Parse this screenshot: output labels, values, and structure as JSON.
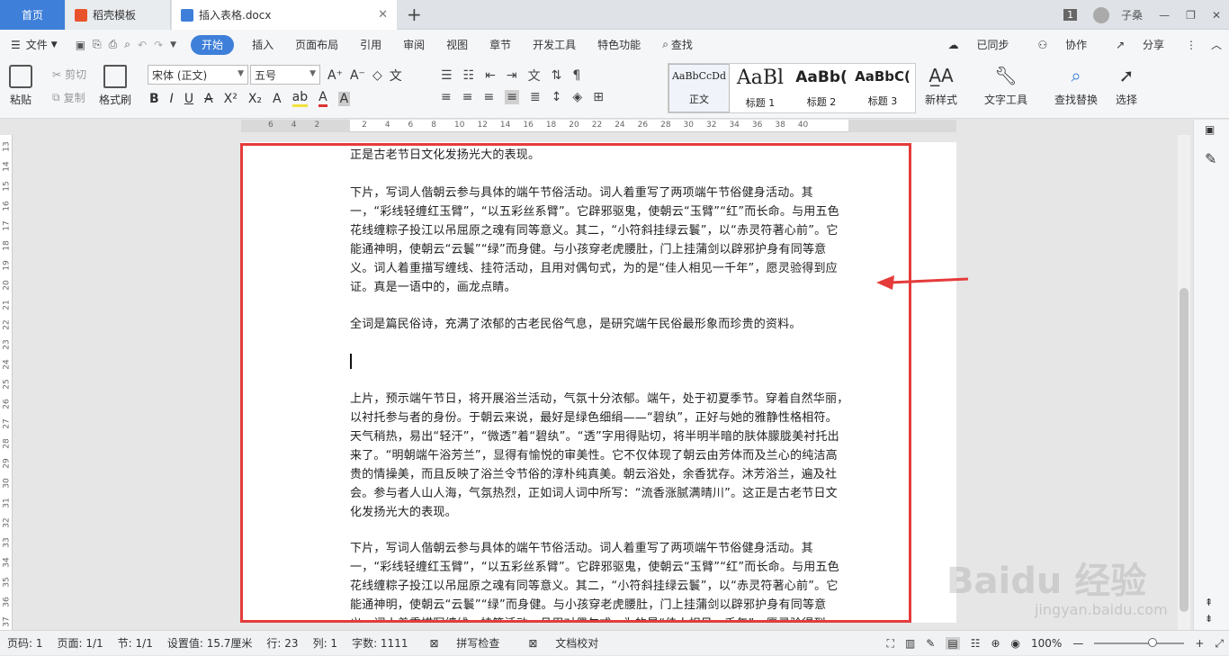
{
  "tabs": {
    "home": "首页",
    "t1": "稻壳模板",
    "t2": "插入表格.docx",
    "user": "子桑",
    "page_num": "1"
  },
  "menu": {
    "file": "文件",
    "items": [
      "开始",
      "插入",
      "页面布局",
      "引用",
      "审阅",
      "视图",
      "章节",
      "开发工具",
      "特色功能",
      "查找"
    ],
    "synced": "已同步",
    "collab": "协作",
    "share": "分享"
  },
  "ribbon": {
    "paste": "粘贴",
    "cut": "剪切",
    "copy": "复制",
    "format_painter": "格式刷",
    "font_name": "宋体 (正文)",
    "font_size": "五号",
    "styles": [
      {
        "sample": "AaBbCcDd",
        "name": "正文"
      },
      {
        "sample": "AaBl",
        "name": "标题 1"
      },
      {
        "sample": "AaBb(",
        "name": "标题 2"
      },
      {
        "sample": "AaBbC(",
        "name": "标题 3"
      }
    ],
    "new_style": "新样式",
    "text_tools": "文字工具",
    "find_replace": "查找替换",
    "select": "选择"
  },
  "document": {
    "paragraphs": [
      "正是古老节日文化发扬光大的表现。",
      "下片，写词人偕朝云参与具体的端午节俗活动。词人着重写了两项端午节俗健身活动。其一，“彩线轻缠红玉臂”，“以五彩丝系臂”。它辟邪驱鬼，使朝云“玉臂”“红”而长命。与用五色花线缠粽子投江以吊屈原之魂有同等意义。其二，“小符斜挂绿云鬟”，以“赤灵符著心前”。它能通神明，使朝云“云鬟”“绿”而身健。与小孩穿老虎腰肚，门上挂蒲剑以辟邪护身有同等意义。词人着重描写缠线、挂符活动，且用对偶句式，为的是“佳人相见一千年”，愿灵验得到应证。真是一语中的，画龙点睛。",
      "全词是篇民俗诗，充满了浓郁的古老民俗气息，是研究端午民俗最形象而珍贵的资料。",
      "上片，预示端午节日，将开展浴兰活动，气氛十分浓郁。端午，处于初夏季节。穿着自然华丽，以衬托参与者的身份。于朝云来说，最好是绿色细绢——“碧纨”，正好与她的雅静性格相符。天气稍热，易出“轻汗”，“微透”着“碧纨”。“透”字用得贴切，将半明半暗的肤体朦胧美衬托出来了。“明朝端午浴芳兰”，显得有愉悦的审美性。它不仅体现了朝云由芳体而及兰心的纯洁高贵的情操美，而且反映了浴兰令节俗的淳朴纯真美。朝云浴处，余香犹存。沐芳浴兰，遍及社会。参与者人山人海，气氛热烈，正如词人词中所写：“流香涨腻满晴川”。这正是古老节日文化发扬光大的表现。",
      "下片，写词人偕朝云参与具体的端午节俗活动。词人着重写了两项端午节俗健身活动。其一，“彩线轻缠红玉臂”，“以五彩丝系臂”。它辟邪驱鬼，使朝云“玉臂”“红”而长命。与用五色花线缠粽子投江以吊屈原之魂有同等意义。其二，“小符斜挂绿云鬟”，以“赤灵符著心前”。它能通神明，使朝云“云鬟”“绿”而身健。与小孩穿老虎腰肚，门上挂蒲剑以辟邪护身有同等意义。词人着重描写缠线、挂符活动，且用对偶句式，为的是“佳人相见一千年”，愿灵验得到"
    ]
  },
  "status": {
    "page_code": "页码: 1",
    "page": "页面: 1/1",
    "section": "节: 1/1",
    "setting": "设置值: 15.7厘米",
    "row": "行: 23",
    "col": "列: 1",
    "words": "字数: 1111",
    "spell": "拼写检查",
    "proof": "文档校对",
    "zoom": "100%"
  },
  "watermark": {
    "brand": "Baidu 经验",
    "url": "jingyan.baidu.com"
  },
  "colors": {
    "accent": "#3e7fd9",
    "highlight_box": "#e53b3b"
  }
}
